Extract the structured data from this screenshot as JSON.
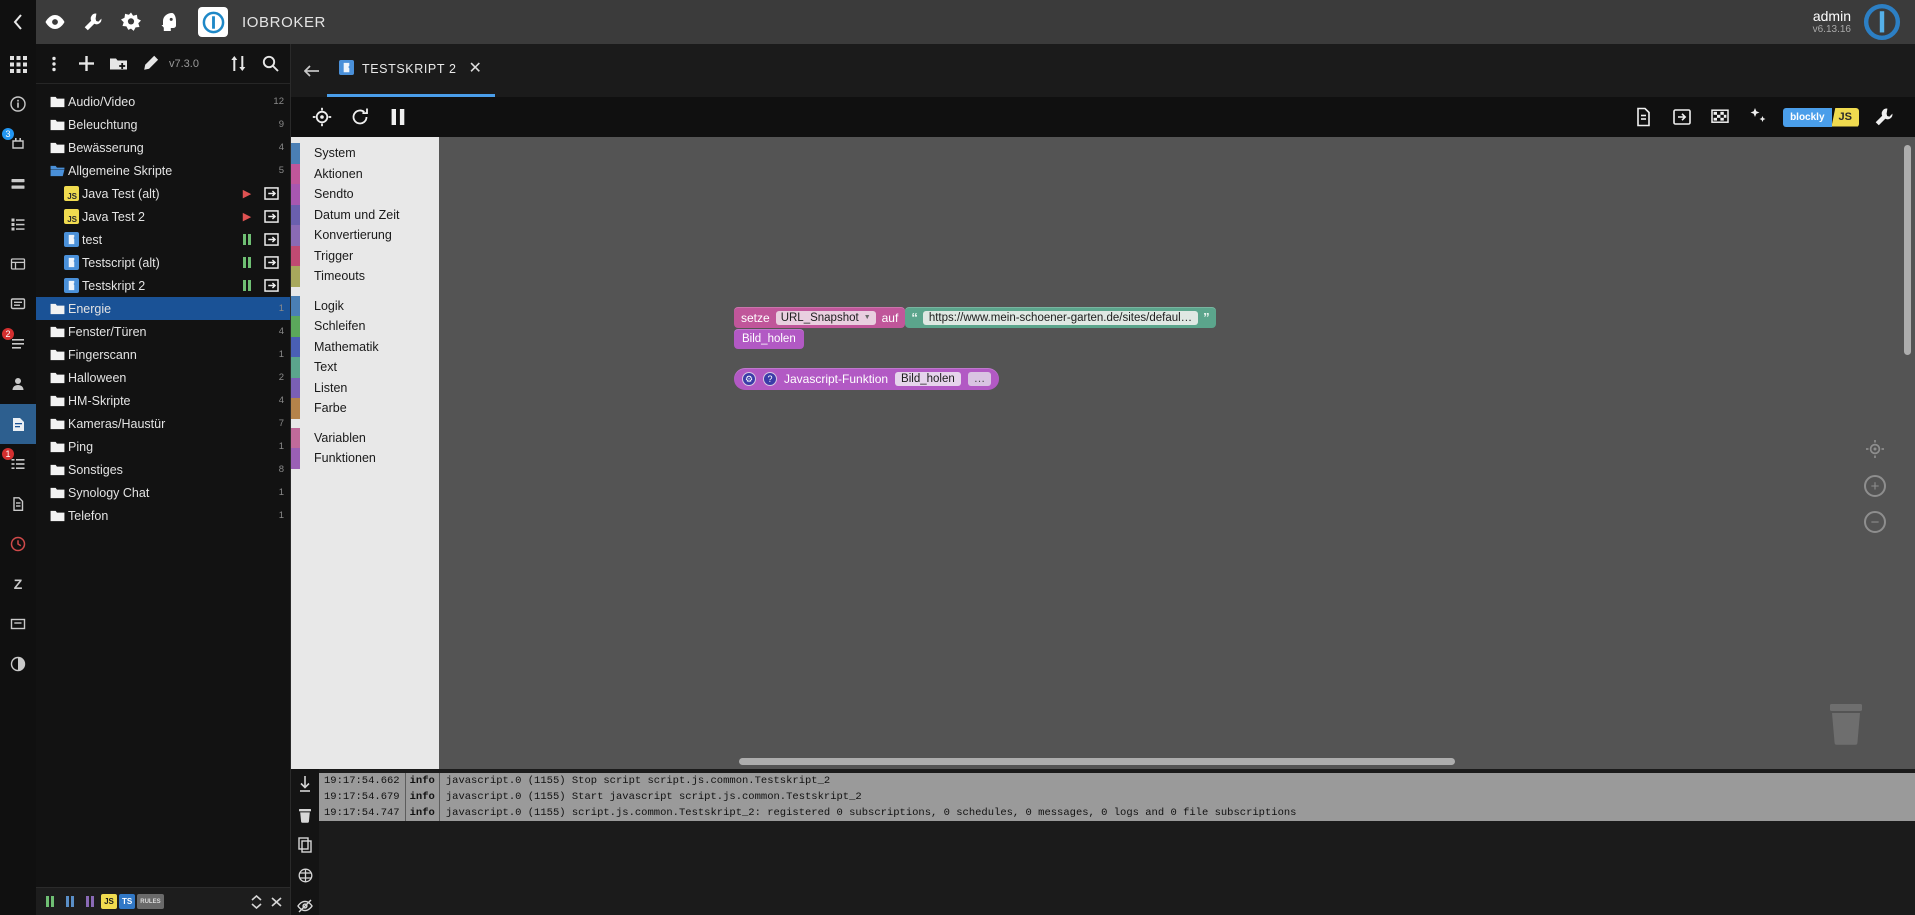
{
  "app": {
    "title": "IOBROKER",
    "user": "admin",
    "version": "v6.13.16"
  },
  "header": {
    "icons": [
      {
        "name": "back-chevron-icon",
        "glyph": "‹"
      },
      {
        "name": "eye-icon",
        "glyph": "eye"
      },
      {
        "name": "wrench-icon",
        "glyph": "wrench"
      },
      {
        "name": "contrast-icon",
        "glyph": "contrast"
      },
      {
        "name": "head-icon",
        "glyph": "head"
      }
    ]
  },
  "tree_toolbar": {
    "more_label": "⋮",
    "add_label": "+",
    "new_folder_label": "folder-plus",
    "edit_label": "pencil",
    "version": "v7.3.0",
    "expand_label": "expand-collapse",
    "search_label": "search"
  },
  "tree": {
    "items": [
      {
        "label": "Audio/Video",
        "type": "folder",
        "depth": 0,
        "count": "12",
        "state": "",
        "selected": false
      },
      {
        "label": "Beleuchtung",
        "type": "folder",
        "depth": 0,
        "count": "9",
        "state": "",
        "selected": false
      },
      {
        "label": "Bewässerung",
        "type": "folder",
        "depth": 0,
        "count": "4",
        "state": "",
        "selected": false
      },
      {
        "label": "Allgemeine Skripte",
        "type": "folder-open",
        "depth": 0,
        "count": "5",
        "state": "",
        "selected": false
      },
      {
        "label": "Java Test (alt)",
        "type": "js",
        "depth": 1,
        "count": "",
        "state": "play",
        "selected": false
      },
      {
        "label": "Java Test 2",
        "type": "js",
        "depth": 1,
        "count": "",
        "state": "play",
        "selected": false
      },
      {
        "label": "test",
        "type": "blockly",
        "depth": 1,
        "count": "",
        "state": "pause",
        "selected": false
      },
      {
        "label": "Testscript (alt)",
        "type": "blockly",
        "depth": 1,
        "count": "",
        "state": "pause",
        "selected": false
      },
      {
        "label": "Testskript 2",
        "type": "blockly",
        "depth": 1,
        "count": "",
        "state": "pause",
        "selected": false
      },
      {
        "label": "Energie",
        "type": "folder",
        "depth": 0,
        "count": "1",
        "state": "",
        "selected": true
      },
      {
        "label": "Fenster/Türen",
        "type": "folder",
        "depth": 0,
        "count": "4",
        "state": "",
        "selected": false
      },
      {
        "label": "Fingerscann",
        "type": "folder",
        "depth": 0,
        "count": "1",
        "state": "",
        "selected": false
      },
      {
        "label": "Halloween",
        "type": "folder",
        "depth": 0,
        "count": "2",
        "state": "",
        "selected": false
      },
      {
        "label": "HM-Skripte",
        "type": "folder",
        "depth": 0,
        "count": "4",
        "state": "",
        "selected": false
      },
      {
        "label": "Kameras/Haustür",
        "type": "folder",
        "depth": 0,
        "count": "7",
        "state": "",
        "selected": false
      },
      {
        "label": "Ping",
        "type": "folder",
        "depth": 0,
        "count": "1",
        "state": "",
        "selected": false
      },
      {
        "label": "Sonstiges",
        "type": "folder",
        "depth": 0,
        "count": "8",
        "state": "",
        "selected": false
      },
      {
        "label": "Synology Chat",
        "type": "folder",
        "depth": 0,
        "count": "1",
        "state": "",
        "selected": false
      },
      {
        "label": "Telefon",
        "type": "folder",
        "depth": 0,
        "count": "1",
        "state": "",
        "selected": false
      }
    ]
  },
  "tree_bottom": {
    "chips": [
      {
        "label": "JS",
        "color": "#f0db4f"
      },
      {
        "label": "TS",
        "color": "#3178c6"
      },
      {
        "label": "RULES",
        "color": "#8a8a8a"
      }
    ]
  },
  "tab": {
    "label": "TESTSKRIPT 2",
    "close_label": "✕"
  },
  "editor_toolbar": {
    "lang_blockly": "blockly",
    "lang_js": "JS"
  },
  "toolbox": {
    "groups": [
      [
        {
          "label": "System",
          "color": "#4a7fb5"
        },
        {
          "label": "Aktionen",
          "color": "#c0569a"
        },
        {
          "label": "Sendto",
          "color": "#a857b0"
        },
        {
          "label": "Datum und Zeit",
          "color": "#6a5fae"
        },
        {
          "label": "Konvertierung",
          "color": "#8a6ab5"
        },
        {
          "label": "Trigger",
          "color": "#c04a72"
        },
        {
          "label": "Timeouts",
          "color": "#a8a85c"
        }
      ],
      [
        {
          "label": "Logik",
          "color": "#4a7fb5"
        },
        {
          "label": "Schleifen",
          "color": "#5ba85b"
        },
        {
          "label": "Mathematik",
          "color": "#4a5fb5"
        },
        {
          "label": "Text",
          "color": "#5ba58c"
        },
        {
          "label": "Listen",
          "color": "#7a5fb5"
        },
        {
          "label": "Farbe",
          "color": "#b5834a"
        }
      ],
      [
        {
          "label": "Variablen",
          "color": "#c06a9a"
        },
        {
          "label": "Funktionen",
          "color": "#9a5fb5"
        }
      ]
    ]
  },
  "blocks": {
    "set_block": {
      "keyword": "setze",
      "variable": "URL_Snapshot",
      "connector": "auf",
      "string_value": "https://www.mein-schoener-garten.de/sites/defaul…",
      "quote_open": "“",
      "quote_close": "”"
    },
    "sub_block": {
      "label": "Bild_holen"
    },
    "function_block": {
      "gear_label": "⚙",
      "help_label": "?",
      "title": "Javascript-Funktion",
      "name": "Bild_holen",
      "mutator": "…"
    }
  },
  "log": {
    "rows": [
      {
        "time": "19:17:54.662",
        "severity": "info",
        "message": "javascript.0 (1155) Stop script script.js.common.Testskript_2"
      },
      {
        "time": "19:17:54.679",
        "severity": "info",
        "message": "javascript.0 (1155) Start javascript script.js.common.Testskript_2"
      },
      {
        "time": "19:17:54.747",
        "severity": "info",
        "message": "javascript.0 (1155) script.js.common.Testskript_2: registered 0 subscriptions, 0 schedules, 0 messages, 0 logs and 0 file subscriptions"
      }
    ]
  },
  "rail": {
    "items": [
      {
        "name": "apps-grid",
        "badge": "",
        "selected": false
      },
      {
        "name": "info",
        "badge": "",
        "selected": false
      },
      {
        "name": "adapters",
        "badge": "3",
        "selected": false
      },
      {
        "name": "instances",
        "badge": "",
        "selected": false
      },
      {
        "name": "objects",
        "badge": "",
        "selected": false
      },
      {
        "name": "states",
        "badge": "",
        "selected": false
      },
      {
        "name": "logs",
        "badge": "",
        "selected": false
      },
      {
        "name": "events",
        "badge": "2",
        "selected": false
      },
      {
        "name": "users",
        "badge": "",
        "selected": false
      },
      {
        "name": "scripts",
        "badge": "",
        "selected": true
      },
      {
        "name": "enums",
        "badge": "1",
        "selected": false
      },
      {
        "name": "files",
        "badge": "",
        "selected": false
      },
      {
        "name": "history",
        "badge": "",
        "selected": false
      },
      {
        "name": "zigbee",
        "badge": "",
        "selected": false
      },
      {
        "name": "text-editor",
        "badge": "",
        "selected": false
      },
      {
        "name": "contrast",
        "badge": "",
        "selected": false
      }
    ]
  },
  "colors": {
    "accent": "#4a9eea",
    "selection": "#1a5296",
    "canvas": "#545454",
    "toolbox_bg": "#e8e8e8",
    "js_yellow": "#f0db4f",
    "running_green": "#6fbf73",
    "stopped_red": "#e05252"
  }
}
